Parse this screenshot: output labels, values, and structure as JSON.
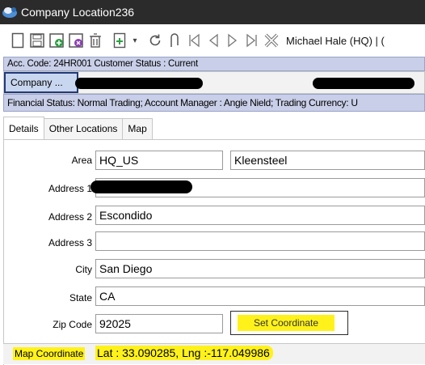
{
  "window": {
    "title": "Company Location236"
  },
  "toolbar": {
    "icons": [
      "new-icon",
      "save-icon",
      "save-new-icon",
      "save-close-icon",
      "delete-icon",
      "add-icon",
      "dropdown-icon",
      "refresh-icon",
      "attach-icon",
      "first-icon",
      "prev-icon",
      "next-icon",
      "last-icon",
      "cancel-icon"
    ],
    "user": "Michael Hale (HQ) | ("
  },
  "info": {
    "acc_line": "Acc. Code: 24HR001  Customer Status : Current",
    "company_label": "Company ...",
    "financial_line": "Financial Status: Normal Trading;  Account Manager : Angie Nield; Trading Currency: U"
  },
  "tabs": [
    "Details",
    "Other Locations",
    "Map"
  ],
  "form": {
    "area_label": "Area",
    "area_value": "HQ_US",
    "area_name": "Kleensteel",
    "address1_label": "Address 1",
    "address1_value": "",
    "address2_label": "Address 2",
    "address2_value": "Escondido",
    "address3_label": "Address 3",
    "address3_value": "",
    "city_label": "City",
    "city_value": "San Diego",
    "state_label": "State",
    "state_value": "CA",
    "zip_label": "Zip Code",
    "zip_value": "92025",
    "set_coord_label": "Set Coordinate",
    "map_coord_label": "Map Coordinate",
    "map_coord_value": "Lat : 33.090285, Lng :-117.049986"
  },
  "colors": {
    "highlight": "#fff21a",
    "info_bar": "#c9cfe8",
    "titlebar": "#2b2b2b"
  }
}
